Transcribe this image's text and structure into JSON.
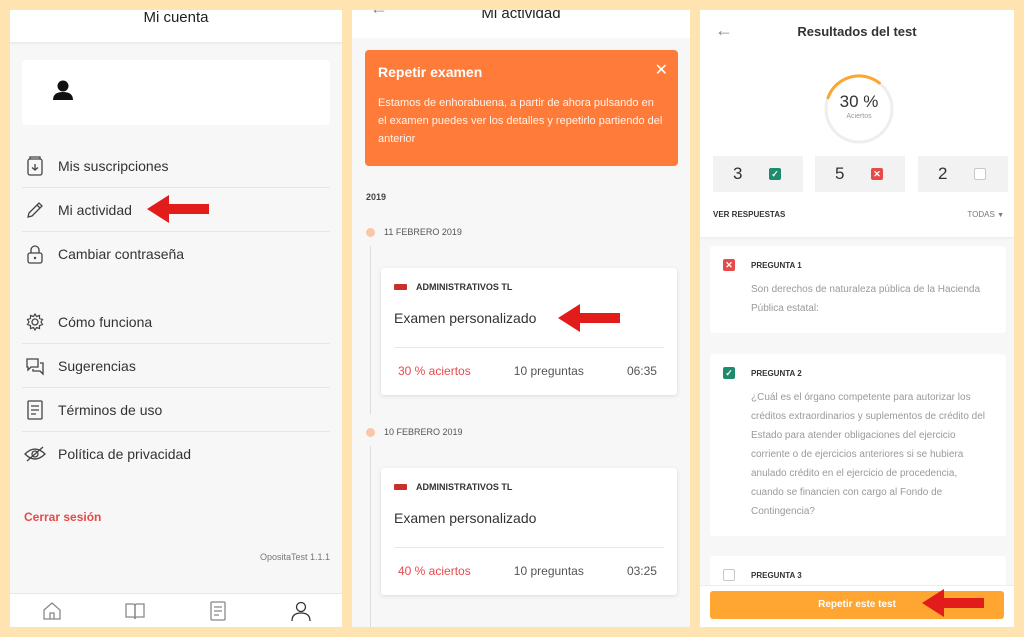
{
  "colors": {
    "accent": "#ff7b3a",
    "orange_button": "#ffa532",
    "red": "#e84a4a",
    "green": "#1e8a6e",
    "background": "#ffe3b0"
  },
  "account": {
    "title": "Mi cuenta",
    "menu_group1": [
      {
        "label": "Mis suscripciones",
        "icon": "subscriptions-icon"
      },
      {
        "label": "Mi actividad",
        "icon": "pencil-icon"
      },
      {
        "label": "Cambiar contraseña",
        "icon": "lock-icon"
      }
    ],
    "menu_group2": [
      {
        "label": "Cómo funciona",
        "icon": "gear-icon"
      },
      {
        "label": "Sugerencias",
        "icon": "chat-icon"
      },
      {
        "label": "Términos de uso",
        "icon": "document-icon"
      },
      {
        "label": "Política de privacidad",
        "icon": "eye-icon"
      }
    ],
    "logout": "Cerrar sesión",
    "version": "OpositaTest 1.1.1",
    "bottom_nav": [
      "home-icon",
      "book-icon",
      "list-icon",
      "user-icon"
    ]
  },
  "activity": {
    "title": "Mi actividad",
    "banner": {
      "title": "Repetir examen",
      "text": "Estamos de enhorabuena, a partir de ahora pulsando en el examen puedes ver los detalles y repetirlo partiendo del anterior"
    },
    "year": "2019",
    "entries": [
      {
        "date": "11 FEBRERO 2019",
        "tag": "ADMINISTRATIVOS TL",
        "title": "Examen personalizado",
        "aciertos": "30 % aciertos",
        "preguntas": "10 preguntas",
        "time": "06:35"
      },
      {
        "date": "10 FEBRERO 2019",
        "tag": "ADMINISTRATIVOS TL",
        "title": "Examen personalizado",
        "aciertos": "40 % aciertos",
        "preguntas": "10 preguntas",
        "time": "03:25"
      }
    ]
  },
  "results": {
    "title": "Resultados del test",
    "percent": "30 %",
    "percent_value": 0.3,
    "percent_label": "Aciertos",
    "scores": {
      "correct": "3",
      "wrong": "5",
      "blank": "2"
    },
    "ver_respuestas": "VER RESPUESTAS",
    "filter": "TODAS",
    "questions": [
      {
        "label": "PREGUNTA 1",
        "status": "wrong",
        "text": "Son derechos de naturaleza pública de la Hacienda Pública estatal:"
      },
      {
        "label": "PREGUNTA 2",
        "status": "correct",
        "text": "¿Cuál es el órgano competente para autorizar los créditos extraordinarios y suplementos de crédito del Estado para atender obligaciones del ejercicio corriente o de ejercicios anteriores si se hubiera anulado crédito en el ejercicio de procedencia, cuando se financien con cargo al Fondo de Contingencia?"
      },
      {
        "label": "PREGUNTA 3",
        "status": "blank",
        "text": ""
      }
    ],
    "repeat_button": "Repetir este test"
  }
}
